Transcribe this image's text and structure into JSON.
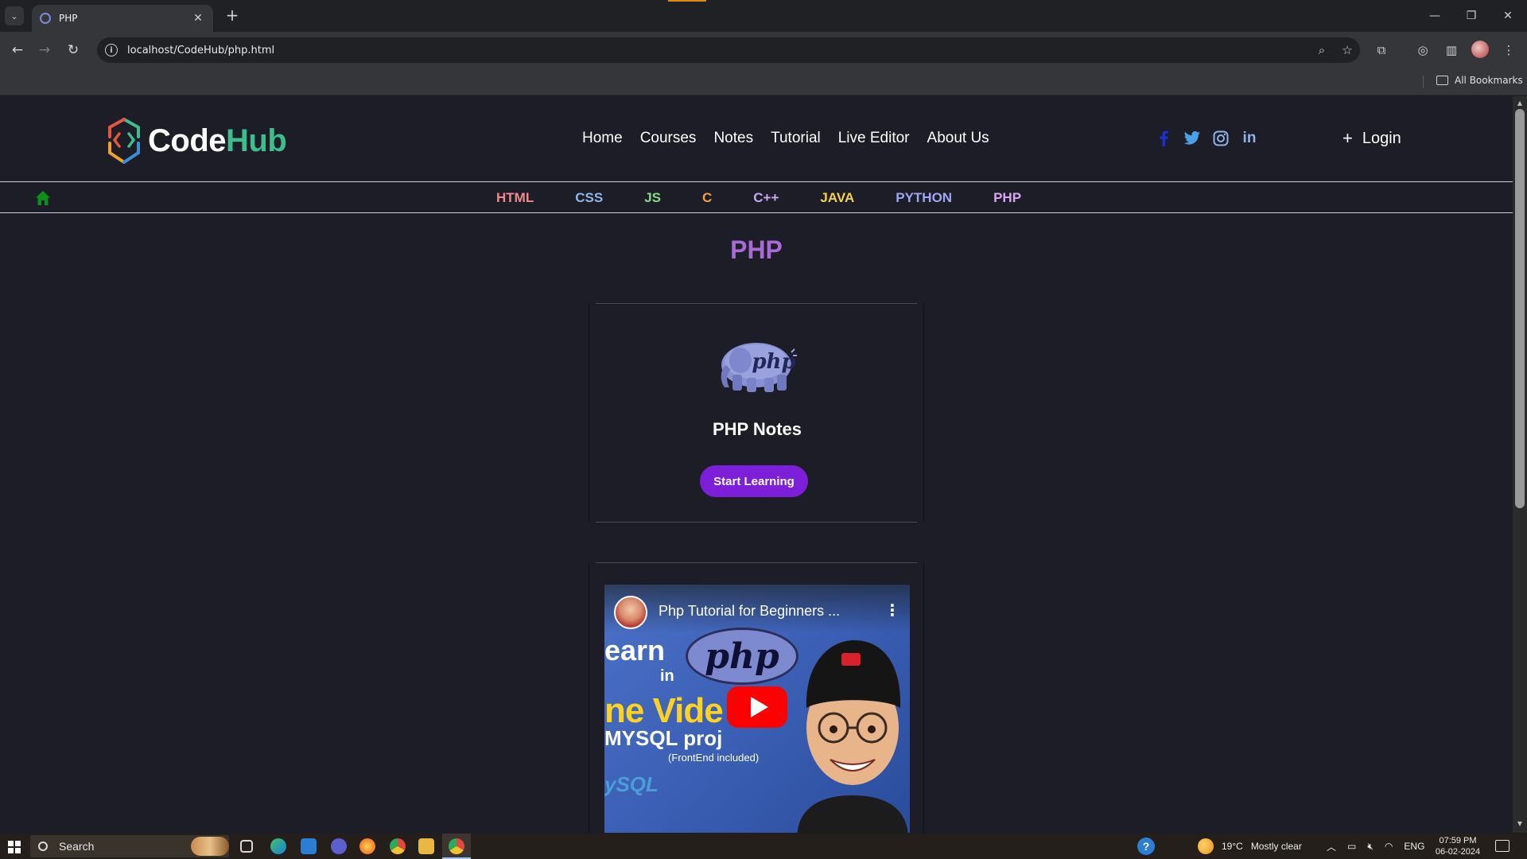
{
  "browser": {
    "tab_title": "PHP",
    "url": "localhost/CodeHub/php.html",
    "all_bookmarks_label": "All Bookmarks"
  },
  "site": {
    "logo_code": "Code",
    "logo_hub": "Hub",
    "nav": [
      "Home",
      "Courses",
      "Notes",
      "Tutorial",
      "Live Editor",
      "About Us"
    ],
    "social_icons": [
      "facebook-icon",
      "twitter-icon",
      "instagram-icon",
      "linkedin-icon"
    ],
    "login_label": "Login",
    "colors": {
      "background": "#1c1d26",
      "logo_hub": "#3dbd8c",
      "title": "#a86ad6",
      "button": "#7d1fd9",
      "home_icon": "#0e8f1a"
    }
  },
  "lang_bar": {
    "items": [
      {
        "label": "HTML",
        "color": "#f08a8a"
      },
      {
        "label": "CSS",
        "color": "#8fb4e8"
      },
      {
        "label": "JS",
        "color": "#8ad98a"
      },
      {
        "label": "C",
        "color": "#f0a04b"
      },
      {
        "label": "C++",
        "color": "#c9a9ef"
      },
      {
        "label": "JAVA",
        "color": "#f5d146"
      },
      {
        "label": "PYTHON",
        "color": "#9aa8f0"
      },
      {
        "label": "PHP",
        "color": "#d7a6f3"
      }
    ]
  },
  "page": {
    "title": "PHP",
    "card_title": "PHP Notes",
    "start_button": "Start Learning"
  },
  "video": {
    "title": "Php Tutorial for Beginners ...",
    "thumb_line1": "earn",
    "thumb_in": "in",
    "thumb_php": "php",
    "thumb_line2": "ne Vide",
    "thumb_line3": "MYSQL proj",
    "thumb_line4": "(FrontEnd included)",
    "thumb_sql": "ySQL"
  },
  "taskbar": {
    "search_label": "Search",
    "weather": "19°C",
    "weather_desc": "Mostly clear",
    "language": "ENG",
    "time": "07:59 PM",
    "date": "06-02-2024"
  }
}
